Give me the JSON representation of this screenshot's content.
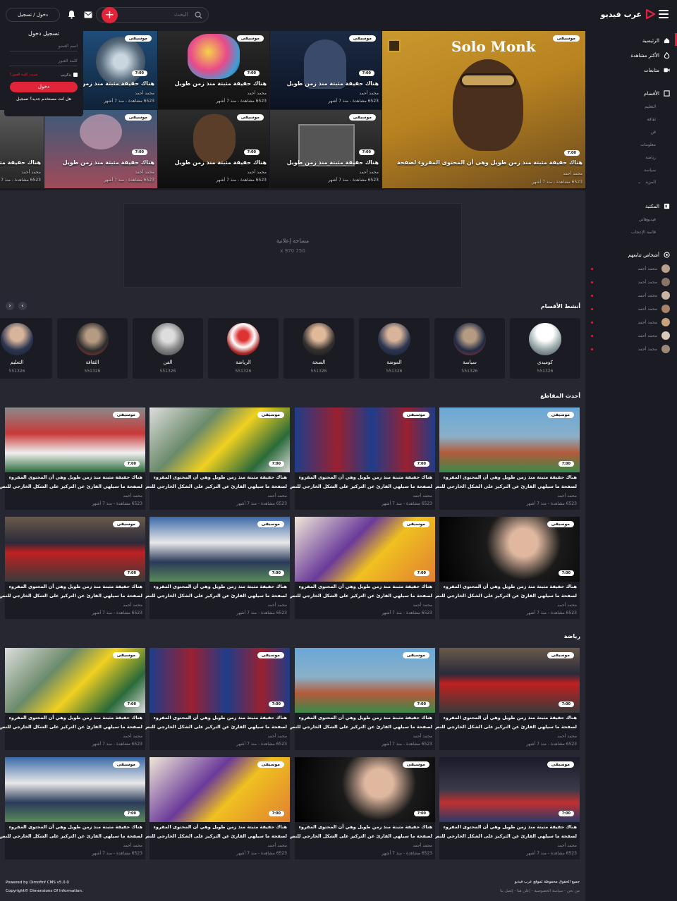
{
  "header": {
    "logo_text": "عرب فيديو",
    "search_placeholder": "البحث",
    "login_button": "دخول / تسجيل"
  },
  "login_panel": {
    "title": "تسجيل دخول",
    "username_placeholder": "اسم العضو",
    "password_placeholder": "كلمة العبور",
    "remember": "تذكرني",
    "forgot": "نسيت كلمة العبور؟",
    "submit": "دخول",
    "register": "هل انت مستخدم جديد؟ تسجيل"
  },
  "sidebar": {
    "main": [
      {
        "label": "الرئيسية",
        "icon": "home-icon"
      },
      {
        "label": "الأكثر مشاهدة",
        "icon": "flame-icon"
      },
      {
        "label": "متابعات",
        "icon": "video-icon"
      }
    ],
    "sections_title": "الأقسام",
    "sections": [
      "التعليم",
      "ثقافة",
      "فن",
      "معلومات",
      "رياضة",
      "سياسة",
      "المزيد"
    ],
    "library_title": "المكتبة",
    "library": [
      "فيديوهاتي",
      "قائمة الإعجاب"
    ],
    "following_title": "أشخاص تتابعهم",
    "people": [
      "محمد أحمد",
      "محمد أحمد",
      "محمد أحمد",
      "محمد أحمد",
      "محمد أحمد",
      "محمد أحمد",
      "محمد أحمد"
    ]
  },
  "common": {
    "badge": "موسيقى",
    "duration": "7:00",
    "title_short": "هناك حقيقة مثبتة منذ زمن طويل",
    "title_long": "هناك حقيقة مثبتة منذ زمن طويل وهي أن المحتوى المقروء لصفحة",
    "card_line1": "هناك حقيقة مثبتة منذ زمن طويل وهي أن المحتوى المقروء",
    "card_line2": "لصفحة ما سيلهي القارئ عن التركيز على الشكل الخارجي للنص",
    "author": "محمد أحمد",
    "meta": "6523 مشاهدة - منذ 7 أشهر"
  },
  "ad": {
    "title": "مساحة إعلانية",
    "size": "750 x 970"
  },
  "categories": {
    "title": "أنشط الأقسام",
    "items": [
      {
        "name": "كوميدي",
        "count": "551326"
      },
      {
        "name": "سياسة",
        "count": "551326"
      },
      {
        "name": "الموضة",
        "count": "551326"
      },
      {
        "name": "الصحة",
        "count": "551326"
      },
      {
        "name": "الرياضة",
        "count": "551326"
      },
      {
        "name": "الفن",
        "count": "551326"
      },
      {
        "name": "الثقافة",
        "count": "551326"
      },
      {
        "name": "التعليم",
        "count": "551326"
      }
    ]
  },
  "latest": {
    "title": "أحدث المقاطع"
  },
  "sports": {
    "title": "رياضة"
  },
  "footer": {
    "rights": "جميع الحقوق محفوظة لموقع عرب فيديو",
    "links": "من نحن  -  سياسة الخصوصية  -  إعلن هنا  -  إتصل بنا",
    "powered": "Powered by Dimofinf CMS v5.0.0",
    "copyright": "Copyright© Dimensions Of Information."
  },
  "colors": {
    "accent": "#e0243a",
    "bg": "#262731",
    "panel": "#1b1c23"
  }
}
